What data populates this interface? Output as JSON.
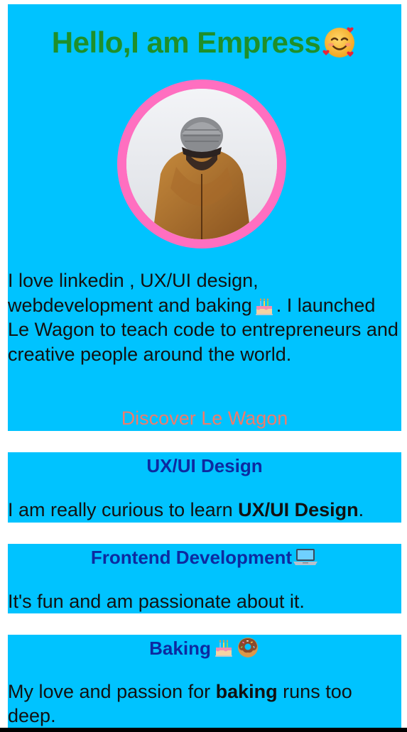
{
  "profile": {
    "heading": "Hello,I am Empress",
    "heading_emoji": "smiling-face-with-hearts-icon",
    "avatar_alt": "profile-photo",
    "bio_part1": "I love linkedin , UX/UI design, webdevelopment and baking",
    "bio_part2": ". I launched Le Wagon to teach code to entrepreneurs and creative people around the world.",
    "cta_label": "Discover Le Wagon"
  },
  "skills": [
    {
      "title": "UX/UI Design",
      "text_before": "I am really curious to learn ",
      "text_bold": "UX/UI Design",
      "text_after": "."
    },
    {
      "title": "Frontend Development",
      "title_icon": "laptop-icon",
      "text": "It's fun and am passionate about it."
    },
    {
      "title": "Baking",
      "title_icons": [
        "birthday-cake-icon",
        "donut-icon"
      ],
      "text_before": "My love and passion for ",
      "text_bold": "baking",
      "text_after": " runs too deep."
    }
  ],
  "colors": {
    "card_background": "#00c3ff",
    "heading": "#1f8f2a",
    "avatar_border": "#ff6fc0",
    "skill_title": "#0d2aa0",
    "cta": "#f27a6a",
    "body_text": "#111111"
  }
}
